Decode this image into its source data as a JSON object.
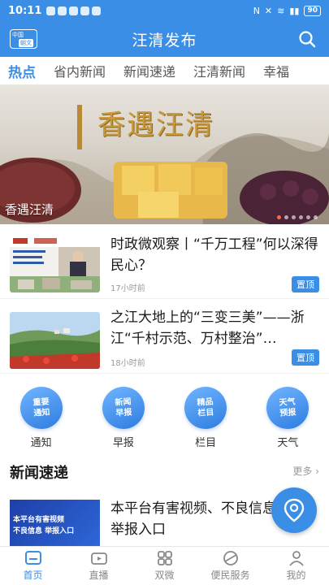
{
  "status": {
    "time": "10:11",
    "battery": "90"
  },
  "header": {
    "title": "汪清发布",
    "logo_top": "中国",
    "logo_bottom": "朝文"
  },
  "tabs": [
    {
      "label": "热点",
      "active": true
    },
    {
      "label": "省内新闻"
    },
    {
      "label": "新闻速递"
    },
    {
      "label": "汪清新闻"
    },
    {
      "label": "幸福"
    }
  ],
  "banner": {
    "caption": "香遇汪清",
    "art_title": "香遇汪清",
    "slide_count": 6,
    "active_slide": 1
  },
  "news": [
    {
      "headline": "时政微观察丨“千万工程”何以深得民心？",
      "time": "17小时前",
      "tag": "置顶"
    },
    {
      "headline": "之江大地上的“三变三美”——浙江“千村示范、万村整治”…",
      "time": "18小时前",
      "tag": "置顶"
    }
  ],
  "quick": [
    {
      "icon_text": "重要\n通知",
      "label": "通知"
    },
    {
      "icon_text": "新闻\n早报",
      "label": "早报"
    },
    {
      "icon_text": "精品\n栏目",
      "label": "栏目"
    },
    {
      "icon_text": "天气\n预报",
      "label": "天气"
    }
  ],
  "section": {
    "title": "新闻速递",
    "more": "更多"
  },
  "brief": {
    "headline": "本平台有害视频、不良信息举报入口",
    "thumb_text": "本平台有害视频\n不良信息 举报入口"
  },
  "nav": [
    {
      "label": "首页",
      "icon": "home-icon",
      "active": true
    },
    {
      "label": "直播",
      "icon": "live-icon"
    },
    {
      "label": "双微",
      "icon": "grid-icon"
    },
    {
      "label": "便民服务",
      "icon": "service-icon"
    },
    {
      "label": "我的",
      "icon": "user-icon"
    }
  ],
  "colors": {
    "brand": "#3a8ee6"
  }
}
